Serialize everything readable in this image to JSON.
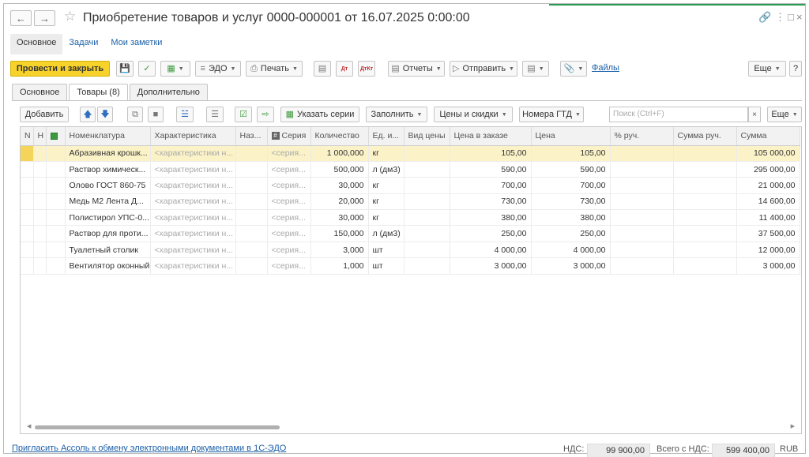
{
  "window": {
    "title": "Приобретение товаров и услуг 0000-000001 от 16.07.2025 0:00:00"
  },
  "subnav": [
    "Основное",
    "Задачи",
    "Мои заметки"
  ],
  "commands": {
    "post_and_close": "Провести и закрыть",
    "edo": "ЭДО",
    "print": "Печать",
    "reports": "Отчеты",
    "send": "Отправить",
    "files": "Файлы",
    "more": "Еще"
  },
  "doc_tabs": [
    "Основное",
    "Товары (8)",
    "Дополнительно"
  ],
  "table_toolbar": {
    "add": "Добавить",
    "specify_series": "Указать серии",
    "fill": "Заполнить",
    "prices_discounts": "Цены и скидки",
    "gtd_numbers": "Номера ГТД",
    "search_placeholder": "Поиск (Ctrl+F)",
    "more": "Еще"
  },
  "table": {
    "columns": [
      "N",
      "Н",
      "",
      "Номенклатура",
      "Характеристика",
      "Наз...",
      "Серия",
      "Количество",
      "Ед. и...",
      "Вид цены",
      "Цена в заказе",
      "Цена",
      "% руч.",
      "Сумма руч.",
      "Сумма"
    ],
    "rows": [
      {
        "name": "Абразивная крошк...",
        "char": "<характеристики н...",
        "series": "<серия...",
        "qty": "1 000,000",
        "unit": "кг",
        "order_price": "105,00",
        "price": "105,00",
        "sum": "105 000,00"
      },
      {
        "name": "Раствор химическ...",
        "char": "<характеристики н...",
        "series": "<серия...",
        "qty": "500,000",
        "unit": "л (дм3)",
        "order_price": "590,00",
        "price": "590,00",
        "sum": "295 000,00"
      },
      {
        "name": "Олово ГОСТ 860-75",
        "char": "<характеристики н...",
        "series": "<серия...",
        "qty": "30,000",
        "unit": "кг",
        "order_price": "700,00",
        "price": "700,00",
        "sum": "21 000,00"
      },
      {
        "name": "Медь М2 Лента Д...",
        "char": "<характеристики н...",
        "series": "<серия...",
        "qty": "20,000",
        "unit": "кг",
        "order_price": "730,00",
        "price": "730,00",
        "sum": "14 600,00"
      },
      {
        "name": "Полистирол УПС-0...",
        "char": "<характеристики н...",
        "series": "<серия...",
        "qty": "30,000",
        "unit": "кг",
        "order_price": "380,00",
        "price": "380,00",
        "sum": "11 400,00"
      },
      {
        "name": "Раствор для проти...",
        "char": "<характеристики н...",
        "series": "<серия...",
        "qty": "150,000",
        "unit": "л (дм3)",
        "order_price": "250,00",
        "price": "250,00",
        "sum": "37 500,00"
      },
      {
        "name": "Туалетный столик",
        "char": "<характеристики н...",
        "series": "<серия...",
        "qty": "3,000",
        "unit": "шт",
        "order_price": "4 000,00",
        "price": "4 000,00",
        "sum": "12 000,00"
      },
      {
        "name": "Вентилятор оконный",
        "char": "<характеристики н...",
        "series": "<серия...",
        "qty": "1,000",
        "unit": "шт",
        "order_price": "3 000,00",
        "price": "3 000,00",
        "sum": "3 000,00"
      }
    ]
  },
  "footer": {
    "invite_link": "Пригласить Ассоль к обмену электронными документами в 1С-ЭДО",
    "vat_label": "НДС:",
    "vat_value": "99 900,00",
    "total_label": "Всего с НДС:",
    "total_value": "599 400,00",
    "currency": "RUB"
  },
  "colors": {
    "primary_button": "#f6d22a",
    "link": "#1a5fa8",
    "selected_row": "#fbf2c8",
    "accent_line": "#2a9d55"
  }
}
